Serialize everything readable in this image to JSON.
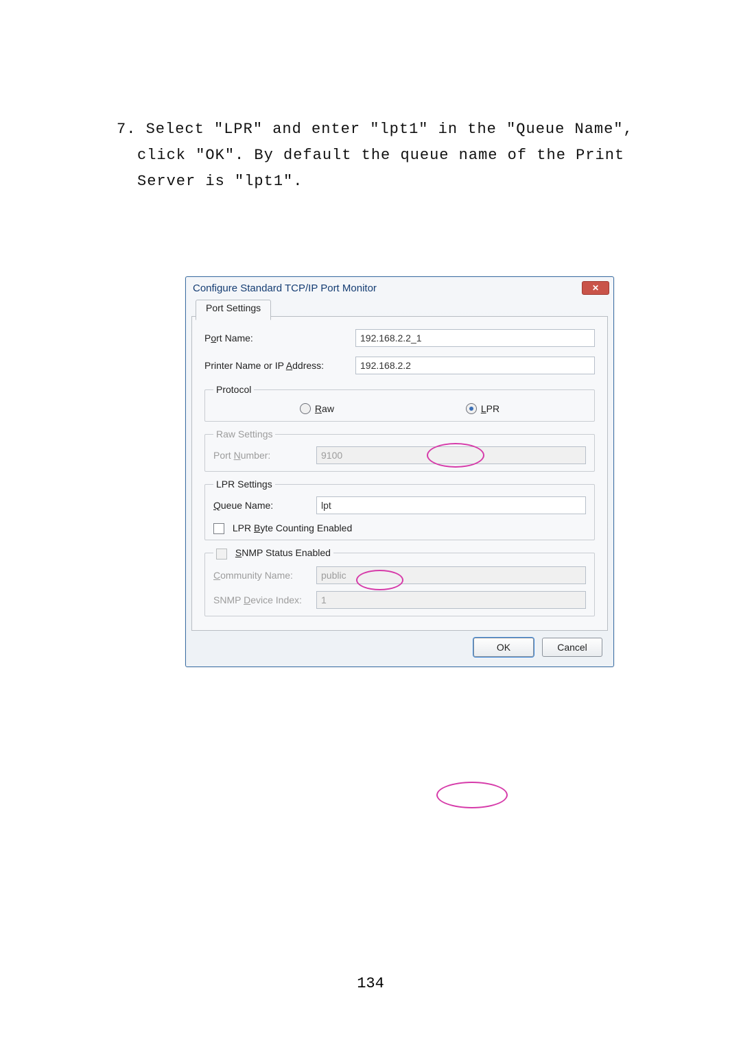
{
  "instruction_text": "7. Select \"LPR\" and enter \"lpt1\" in the \"Queue Name\", click \"OK\". By default the queue name of the Print Server is \"lpt1\".",
  "dialog": {
    "title": "Configure Standard TCP/IP Port Monitor",
    "close_glyph": "✕",
    "tab": "Port Settings",
    "port_name_label_pre": "P",
    "port_name_label_u": "o",
    "port_name_label_post": "rt Name:",
    "port_name_value": "192.168.2.2_1",
    "ip_label_pre": "Printer Name or IP ",
    "ip_label_u": "A",
    "ip_label_post": "ddress:",
    "ip_value": "192.168.2.2",
    "protocol_legend": "Protocol",
    "raw_pre": "",
    "raw_u": "R",
    "raw_post": "aw",
    "lpr_pre": "",
    "lpr_u": "L",
    "lpr_post": "PR",
    "raw_settings_legend": "Raw Settings",
    "port_number_label_pre": "Port ",
    "port_number_label_u": "N",
    "port_number_label_post": "umber:",
    "port_number_value": "9100",
    "lpr_settings_legend": "LPR Settings",
    "queue_label_pre": "",
    "queue_label_u": "Q",
    "queue_label_post": "ueue Name:",
    "queue_value": "lpt",
    "byte_count_pre": "LPR ",
    "byte_count_u": "B",
    "byte_count_post": "yte Counting Enabled",
    "snmp_legend_pre": "",
    "snmp_legend_u": "S",
    "snmp_legend_post": "NMP Status Enabled",
    "community_label_pre": "",
    "community_label_u": "C",
    "community_label_post": "ommunity Name:",
    "community_value": "public",
    "device_index_label_pre": "SNMP ",
    "device_index_label_u": "D",
    "device_index_label_post": "evice Index:",
    "device_index_value": "1",
    "ok": "OK",
    "cancel": "Cancel"
  },
  "page_number": "134"
}
